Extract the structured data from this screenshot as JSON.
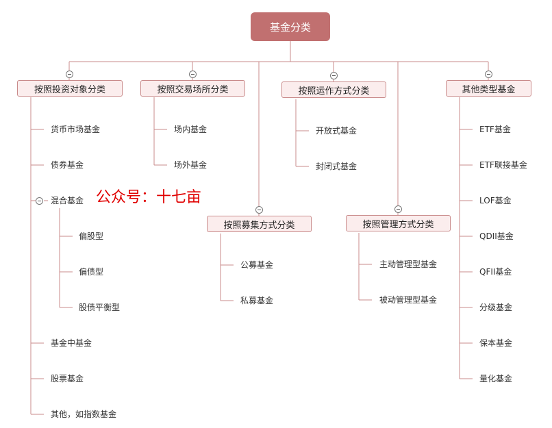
{
  "root": "基金分类",
  "watermark": "公众号：十七亩",
  "categories": [
    {
      "label": "按照投资对象分类"
    },
    {
      "label": "按照交易场所分类"
    },
    {
      "label": "按照运作方式分类"
    },
    {
      "label": "其他类型基金"
    },
    {
      "label": "按照募集方式分类"
    },
    {
      "label": "按照管理方式分类"
    }
  ],
  "leaves": {
    "invest": [
      "货币市场基金",
      "债券基金",
      "混合基金",
      "基金中基金",
      "股票基金",
      "其他，如指数基金"
    ],
    "mixed": [
      "偏股型",
      "偏债型",
      "股债平衡型"
    ],
    "venue": [
      "场内基金",
      "场外基金"
    ],
    "operation": [
      "开放式基金",
      "封闭式基金"
    ],
    "raising": [
      "公募基金",
      "私募基金"
    ],
    "management": [
      "主动管理型基金",
      "被动管理型基金"
    ],
    "other": [
      "ETF基金",
      "ETF联接基金",
      "LOF基金",
      "QDII基金",
      "QFII基金",
      "分级基金",
      "保本基金",
      "量化基金"
    ]
  }
}
